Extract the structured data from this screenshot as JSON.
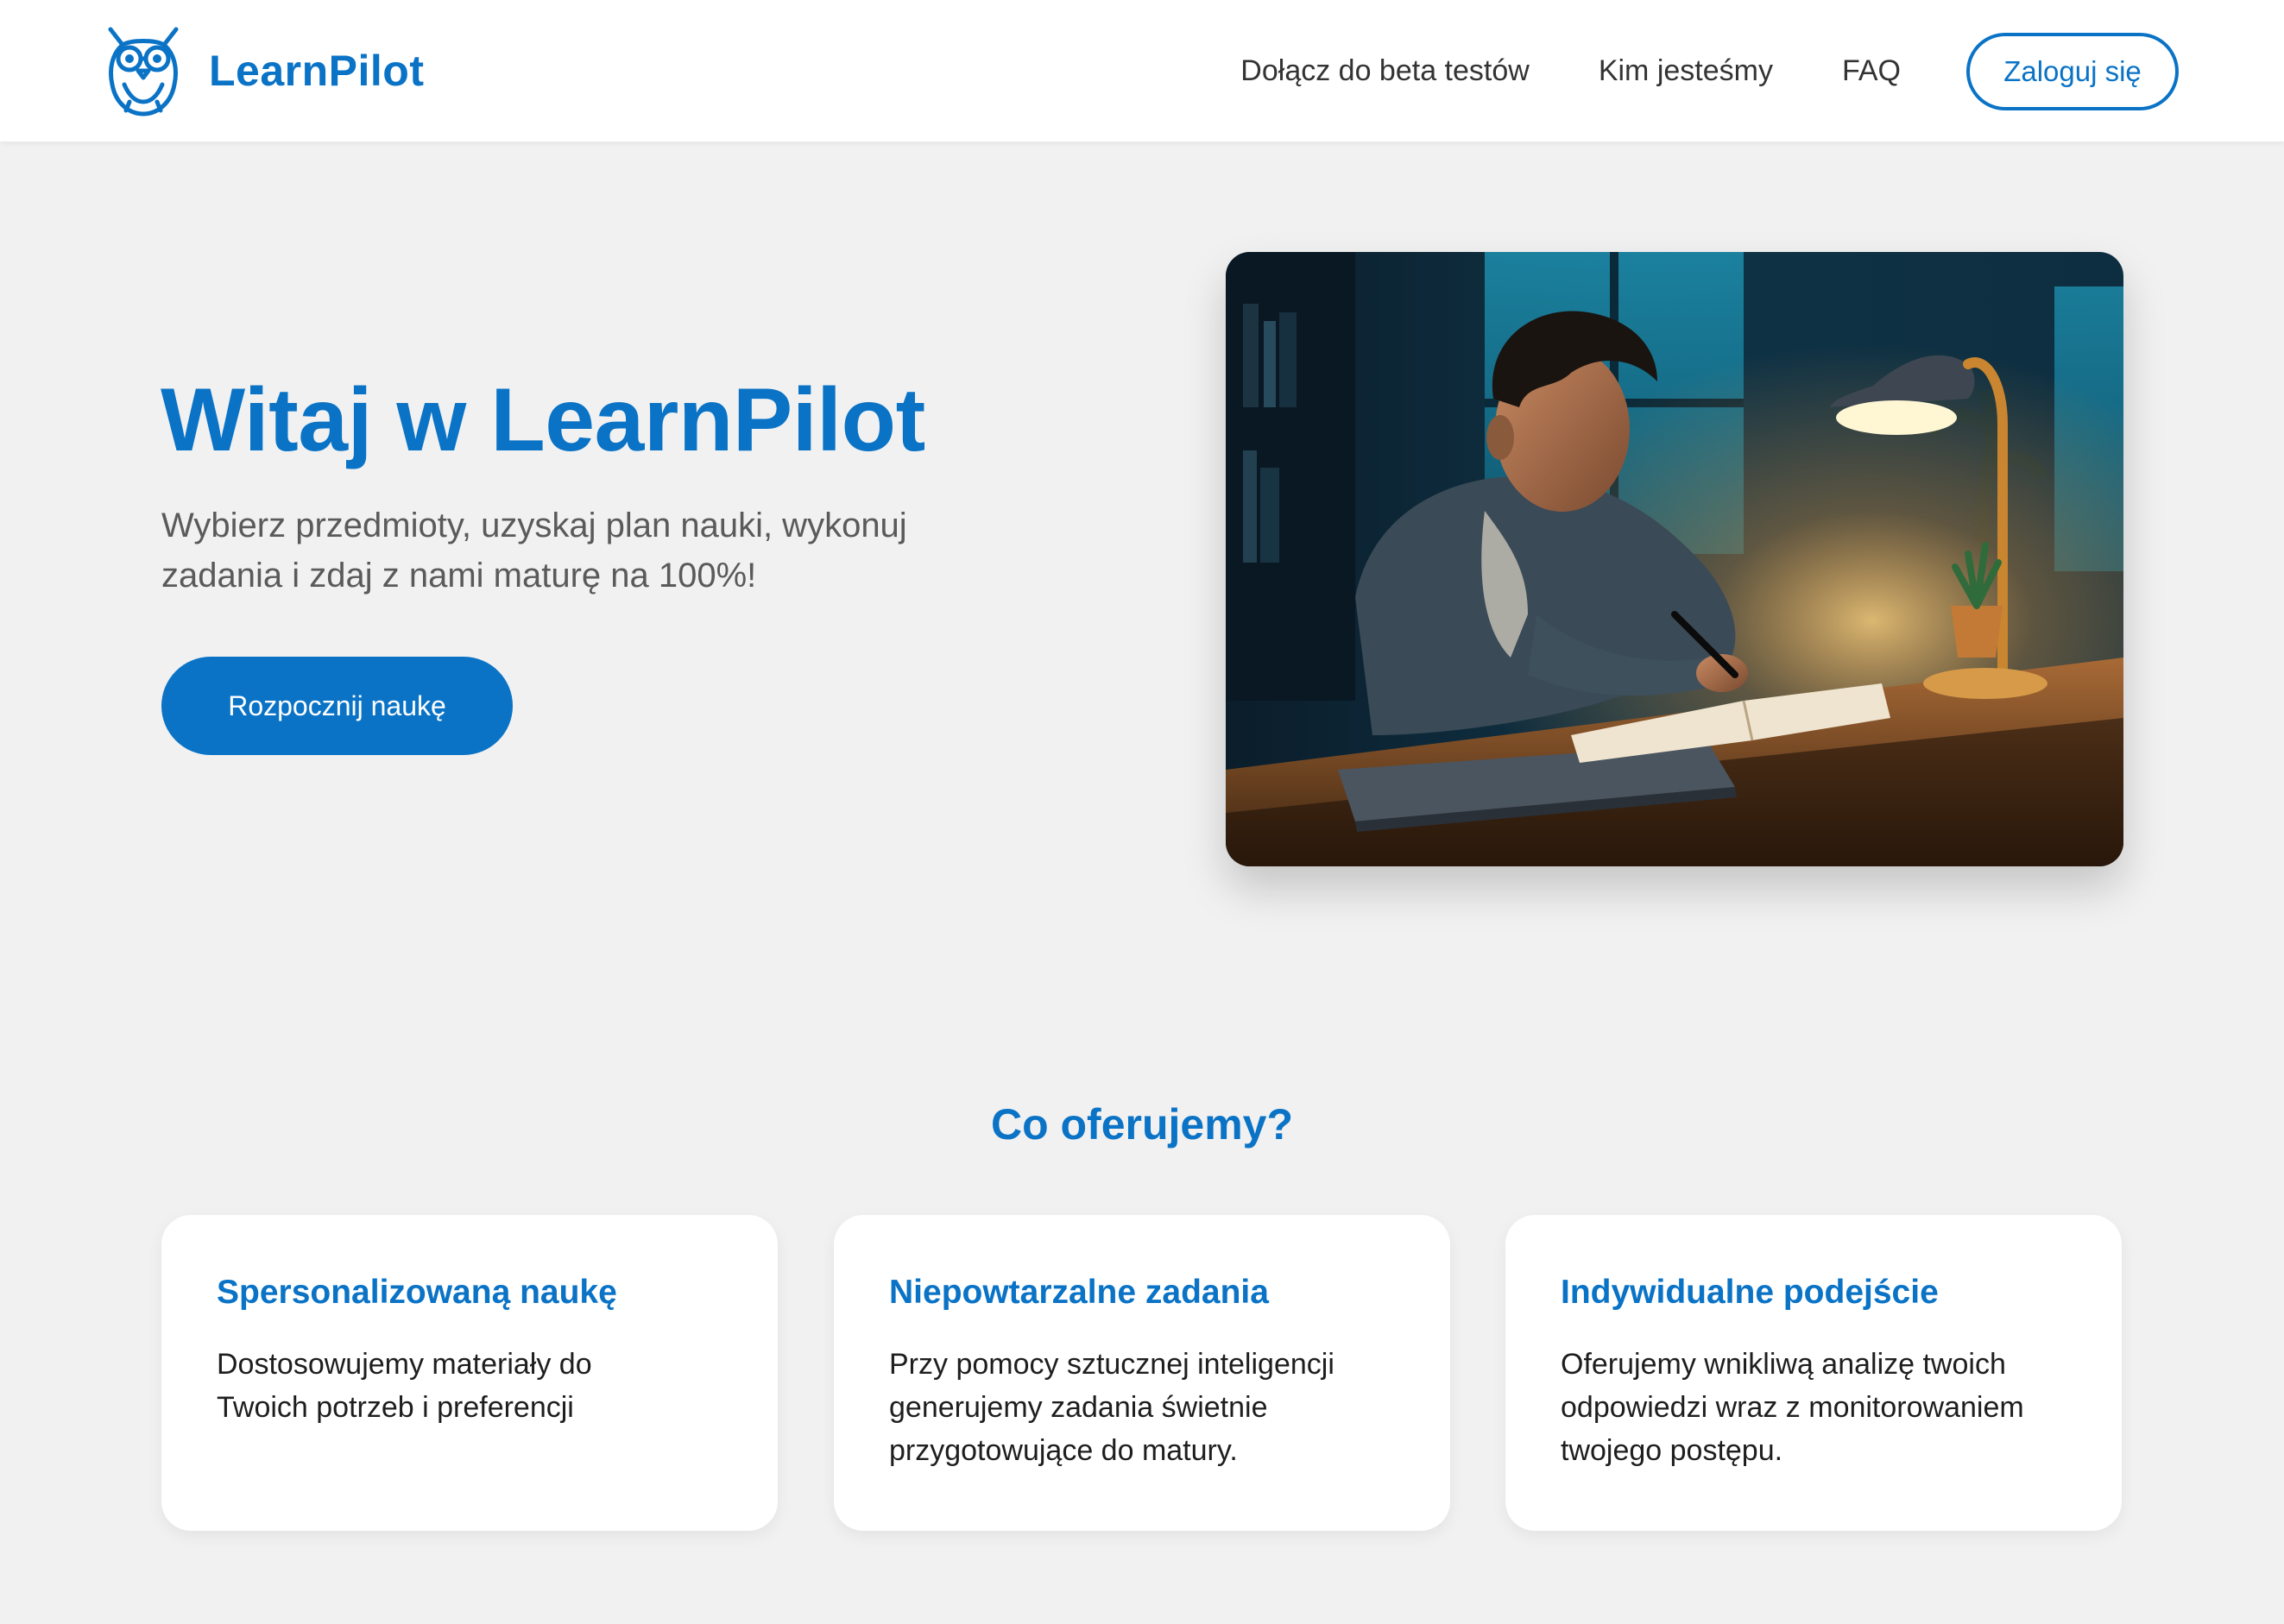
{
  "brand": {
    "name": "LearnPilot",
    "logo_icon": "owl-icon"
  },
  "nav": {
    "links": [
      "Dołącz do beta testów",
      "Kim jesteśmy",
      "FAQ"
    ],
    "login_label": "Zaloguj się"
  },
  "hero": {
    "title": "Witaj w LearnPilot",
    "subtitle": "Wybierz przedmioty, uzyskaj plan nauki, wykonuj zadania i zdaj z nami maturę na 100%!",
    "cta_label": "Rozpocznij naukę",
    "image_alt": "Student uczący się nocą przy lampie"
  },
  "features": {
    "title": "Co oferujemy?",
    "cards": [
      {
        "title": "Spersonalizowaną naukę",
        "description": "Dostosowujemy materiały do Twoich potrzeb i preferencji"
      },
      {
        "title": "Niepowtarzalne zadania",
        "description": "Przy pomocy sztucznej inteligencji generujemy zadania świetnie przygotowujące do matury."
      },
      {
        "title": "Indywidualne podejście",
        "description": "Oferujemy wnikliwą analizę twoich odpowiedzi wraz z monitorowaniem twojego postępu."
      }
    ]
  },
  "colors": {
    "accent": "#0a73c6",
    "background": "#f1f1f1",
    "card": "#ffffff",
    "text_muted": "#5a5a5a"
  }
}
